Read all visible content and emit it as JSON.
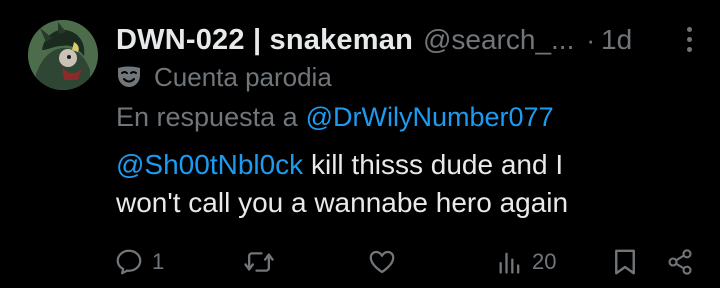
{
  "tweet": {
    "display_name": "DWN-022 | snakeman",
    "handle": "@search_...",
    "separator": "·",
    "time": "1d",
    "parody_label": "Cuenta parodia",
    "reply_prefix": "En respuesta a",
    "reply_to": "@DrWilyNumber077",
    "mention": "@Sh00tNbl0ck",
    "text_line1": " kill thisss dude and I",
    "text_line2": "won't call you a wannabe hero again"
  },
  "actions": {
    "reply_count": "1",
    "retweet_count": "",
    "like_count": "",
    "views_count": "20"
  },
  "colors": {
    "background": "#000000",
    "primary_text": "#e7e9ea",
    "secondary_text": "#71767b",
    "link": "#1d9bf0"
  },
  "icons": [
    "more-icon",
    "parody-mask-icon",
    "reply-icon",
    "retweet-icon",
    "like-icon",
    "views-icon",
    "bookmark-icon",
    "share-icon"
  ]
}
